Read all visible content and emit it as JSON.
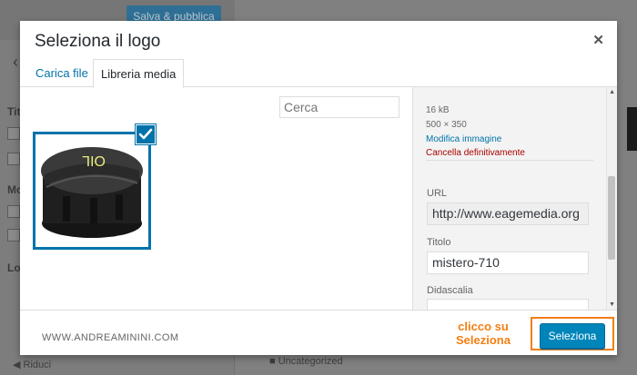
{
  "background": {
    "save_button": "Salva & pubblica",
    "collapse_label": "Riduci",
    "category_label": "Uncategorized"
  },
  "modal": {
    "title": "Seleziona il logo",
    "tabs": [
      {
        "label": "Carica file",
        "active": false
      },
      {
        "label": "Libreria media",
        "active": true
      }
    ],
    "search": {
      "placeholder": "Cerca",
      "value": ""
    }
  },
  "thumbnail": {
    "image_text": "OIL",
    "selected": true
  },
  "details": {
    "file_size": "16 kB",
    "dimensions": "500 × 350",
    "edit_link": "Modifica immagine",
    "delete_link": "Cancella definitivamente",
    "url_label": "URL",
    "url_value": "http://www.eagemedia.org",
    "title_label": "Titolo",
    "title_value": "mistero-710",
    "caption_label": "Didascalia",
    "caption_value": ""
  },
  "footer": {
    "watermark": "WWW.ANDREAMININI.COM",
    "annotation_line1": "clicco su",
    "annotation_line2": "Seleziona",
    "select_button": "Seleziona"
  },
  "colors": {
    "accent": "#0073aa",
    "primary_button": "#0085ba",
    "highlight": "#f47e12",
    "delete": "#aa0000"
  }
}
